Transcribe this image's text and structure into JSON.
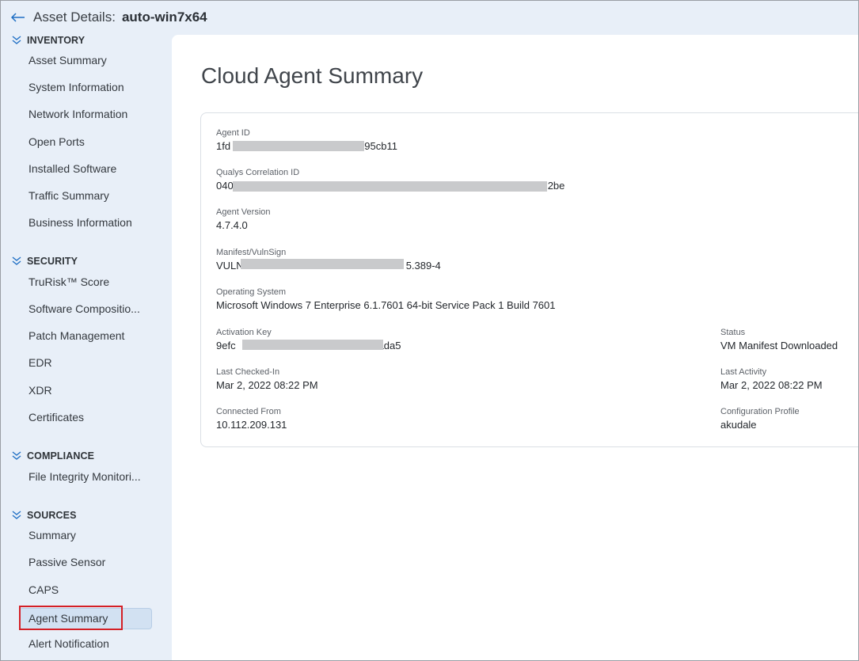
{
  "header": {
    "label": "Asset Details:",
    "asset_name": "auto-win7x64"
  },
  "sidebar": {
    "sections": [
      {
        "title": "INVENTORY",
        "items": [
          "Asset Summary",
          "System Information",
          "Network Information",
          "Open Ports",
          "Installed Software",
          "Traffic Summary",
          "Business Information"
        ]
      },
      {
        "title": "SECURITY",
        "items": [
          "TruRisk™ Score",
          "Software Compositio...",
          "Patch Management",
          "EDR",
          "XDR",
          "Certificates"
        ]
      },
      {
        "title": "COMPLIANCE",
        "items": [
          "File Integrity Monitori..."
        ]
      },
      {
        "title": "SOURCES",
        "items": [
          "Summary",
          "Passive Sensor",
          "CAPS",
          "Agent Summary",
          "Alert Notification"
        ]
      }
    ],
    "active_item": "Agent Summary"
  },
  "main": {
    "title": "Cloud Agent Summary",
    "fields": {
      "agent_id": {
        "label": "Agent ID",
        "value_start": "1fd",
        "value_end": "795cb11"
      },
      "correlation_id": {
        "label": "Qualys Correlation ID",
        "value_start": "040",
        "value_end": "2be"
      },
      "agent_version": {
        "label": "Agent Version",
        "value": "4.7.4.0"
      },
      "manifest": {
        "label": "Manifest/VulnSign",
        "value_start": "VULN",
        "value_end": "5.389-4"
      },
      "os": {
        "label": "Operating System",
        "value": "Microsoft Windows 7 Enterprise 6.1.7601 64-bit Service Pack 1 Build 7601"
      },
      "activation_key": {
        "label": "Activation Key",
        "value_start": "9efc",
        "value_end": "ada5"
      },
      "status": {
        "label": "Status",
        "value": "VM Manifest Downloaded"
      },
      "last_checked_in": {
        "label": "Last Checked-In",
        "value": "Mar 2, 2022 08:22 PM"
      },
      "last_activity": {
        "label": "Last Activity",
        "value": "Mar 2, 2022 08:22 PM"
      },
      "connected_from": {
        "label": "Connected From",
        "value": "10.112.209.131"
      },
      "config_profile": {
        "label": "Configuration Profile",
        "value": "akudale"
      }
    }
  },
  "colors": {
    "sidebar_bg": "#e8eff8",
    "accent": "#1f6fc4",
    "highlight": "#d41f26"
  }
}
